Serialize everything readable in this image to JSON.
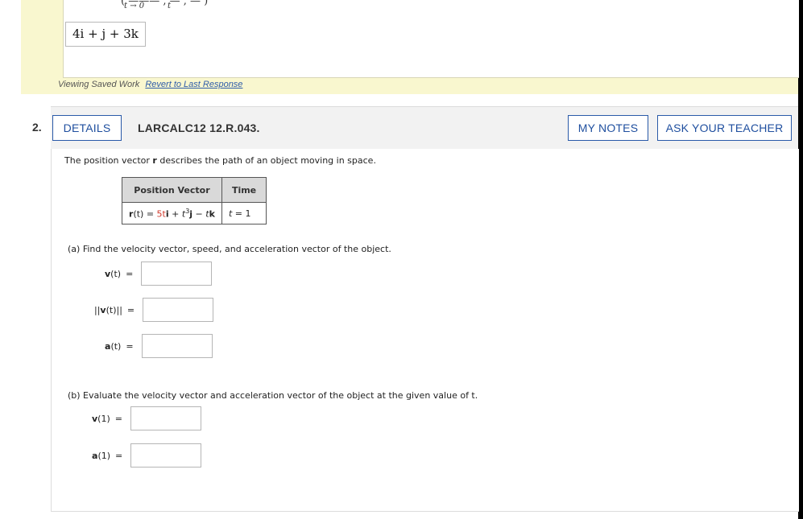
{
  "previous": {
    "limit_fragment": "( ——— , — , — )",
    "limit_under": "t → 0",
    "limit_denominator": "t",
    "answer": "4i + j + 3k",
    "saved_text": "Viewing Saved Work",
    "revert_link": "Revert to Last Response"
  },
  "question": {
    "number": "2.",
    "details_label": "DETAILS",
    "id": "LARCALC12 12.R.043.",
    "notes_label": "MY NOTES",
    "teacher_label": "ASK YOUR TEACHER",
    "intro_pre": "The position vector ",
    "intro_bold": "r",
    "intro_post": " describes the path of an object moving in space.",
    "table": {
      "headers": [
        "Position Vector",
        "Time"
      ],
      "r_label": "r",
      "r_t_arg": "(t) = ",
      "r_expr": "5t",
      "i": "i",
      "plus": " + ",
      "t3": "t",
      "exp3": "3",
      "j": "j",
      "minus": " − ",
      "tk_t": "t",
      "k": "k",
      "time_t": "t",
      "time_val": " = 1"
    },
    "part_a": "(a)  Find the velocity vector, speed, and acceleration vector of the object.",
    "part_b": "(b)  Evaluate the velocity vector and acceleration vector of the object at the given value of t.",
    "a_rows": [
      {
        "bold": "v",
        "rest": "(t)",
        "pre": "",
        "post": ""
      },
      {
        "bold": "v",
        "rest": "(t)",
        "pre": "||",
        "post": "||"
      },
      {
        "bold": "a",
        "rest": "(t)",
        "pre": "",
        "post": ""
      }
    ],
    "b_rows": [
      {
        "bold": "v",
        "rest": "(1)"
      },
      {
        "bold": "a",
        "rest": "(1)"
      }
    ],
    "equals": "="
  }
}
